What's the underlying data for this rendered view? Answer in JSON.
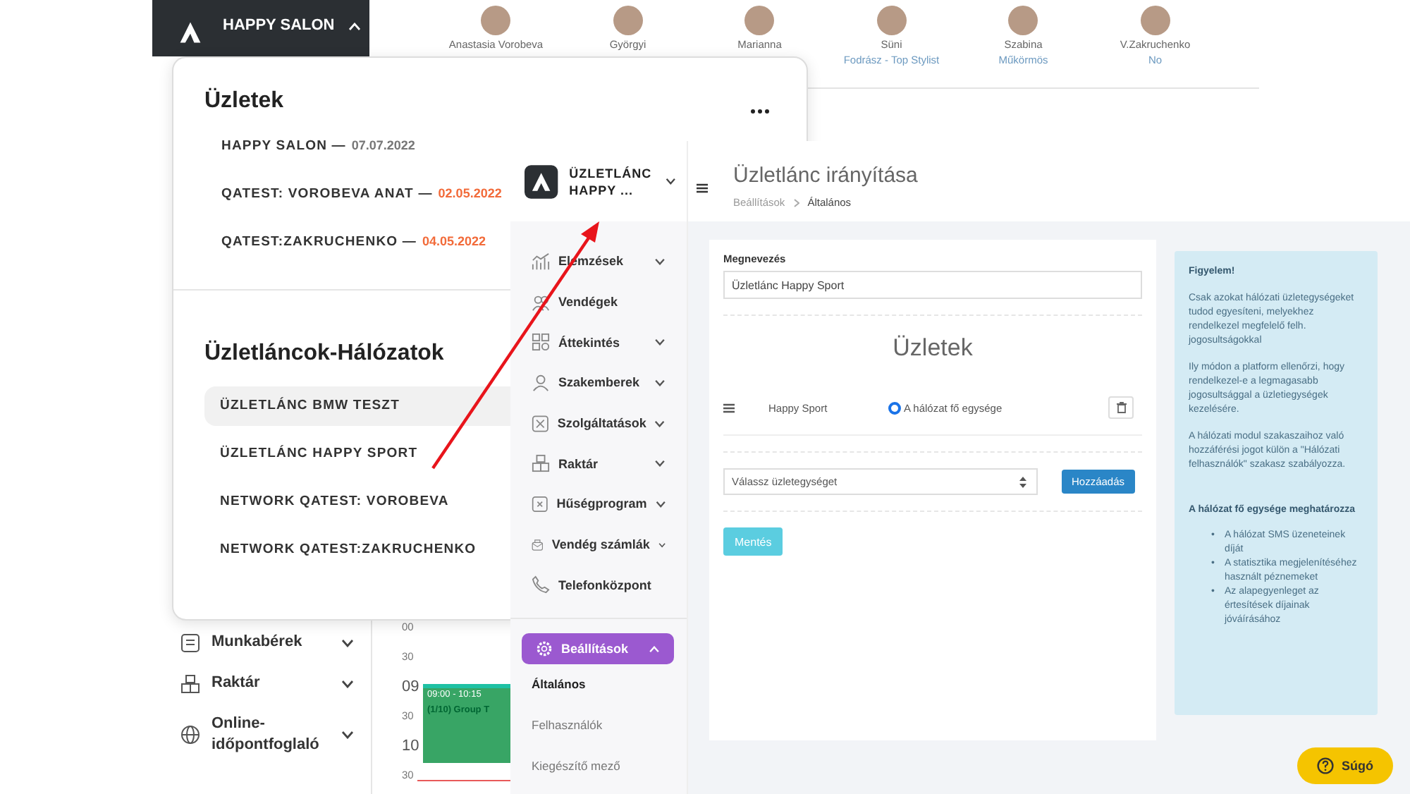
{
  "background_app": {
    "salon_switcher": {
      "label": "HAPPY SALON",
      "expanded": true
    },
    "staff": [
      {
        "name": "Anastasia Vorobeva"
      },
      {
        "name": "Györgyi"
      },
      {
        "name": "Marianna"
      },
      {
        "name": "Süni",
        "role": "Fodrász - Top Stylist"
      },
      {
        "name": "Szabina",
        "role": "Műkörmös"
      },
      {
        "name": "V.Zakruchenko",
        "role": "No"
      }
    ],
    "sidebar_items": [
      {
        "label": "Munkabérek",
        "kind": "payroll"
      },
      {
        "label": "Raktár",
        "kind": "boxes"
      },
      {
        "label": "Online-időpontfoglaló",
        "kind": "globe"
      }
    ],
    "calendar": {
      "time_labels": [
        {
          "text": "00",
          "kind": "minute"
        },
        {
          "text": "30",
          "kind": "minute"
        },
        {
          "text": "09",
          "kind": "hour"
        },
        {
          "text": "30",
          "kind": "minute"
        },
        {
          "text": "10",
          "kind": "hour"
        },
        {
          "text": "30",
          "kind": "minute"
        }
      ],
      "event": {
        "time": "09:00 - 10:15",
        "title": "(1/10) Group T"
      }
    }
  },
  "dropdown": {
    "stores_title": "Üzletek",
    "stores": [
      {
        "name": "HAPPY SALON —",
        "date": "07.07.2022",
        "color": "#777777"
      },
      {
        "name": "QATEST: VOROBEVA ANAT —",
        "date": "02.05.2022",
        "color": "#f26b3a"
      },
      {
        "name": "QATEST:ZAKRUCHENKO —",
        "date": "04.05.2022",
        "color": "#f26b3a"
      }
    ],
    "networks_title": "Üzletláncok-Hálózatok",
    "networks": [
      {
        "label": "ÜZLETLÁNC BMW TESZT",
        "selected": true
      },
      {
        "label": "ÜZLETLÁNC HAPPY SPORT",
        "selected": false
      },
      {
        "label": "NETWORK QATEST: VOROBEVA",
        "selected": false
      },
      {
        "label": "NETWORK QATEST:ZAKRUCHENKO",
        "selected": false
      }
    ]
  },
  "window": {
    "brand": "ÜZLETLÁNC HAPPY ...",
    "menu": [
      {
        "label": "Elemzések",
        "kind": "chart",
        "has_submenu": true
      },
      {
        "label": "Vendégek",
        "kind": "users",
        "has_submenu": false
      },
      {
        "label": "Áttekintés",
        "kind": "grid",
        "has_submenu": true
      },
      {
        "label": "Szakemberek",
        "kind": "person",
        "has_submenu": true
      },
      {
        "label": "Szolgáltatások",
        "kind": "scissors",
        "has_submenu": true
      },
      {
        "label": "Raktár",
        "kind": "boxes",
        "has_submenu": true
      },
      {
        "label": "Hűségprogram",
        "kind": "loyalty",
        "has_submenu": true
      },
      {
        "label": "Vendég számlák",
        "kind": "wallet",
        "has_submenu": true
      },
      {
        "label": "Telefonközpont",
        "kind": "phone",
        "has_submenu": false
      }
    ],
    "settings": {
      "label": "Beállítások",
      "expanded": true,
      "selected": true
    },
    "submenu": [
      {
        "label": "Általános",
        "selected": true
      },
      {
        "label": "Felhasználók",
        "selected": false
      },
      {
        "label": "Kiegészítő mező",
        "selected": false
      }
    ],
    "title": "Üzletlánc irányítása",
    "breadcrumb": [
      "Beállítások",
      "Általános"
    ],
    "form": {
      "name_label": "Megnevezés",
      "name_value": "Üzletlánc Happy Sport",
      "stores_heading": "Üzletek",
      "store_rows": [
        {
          "name": "Happy Sport",
          "main_label": "A hálózat fő egysége",
          "main": true
        }
      ],
      "select_placeholder": "Válassz üzletegységet",
      "add_button": "Hozzáadás",
      "save_button": "Mentés"
    },
    "info": {
      "title": "Figyelem!",
      "paragraphs": [
        "Csak azokat hálózati üzletegységeket tudod egyesíteni, melyekhez rendelkezel megfelelő felh. jogosultságokkal",
        "Ily módon a platform ellenőrzi, hogy rendelkezel-e a legmagasabb jogosultsággal a üzletiegységek kezelésére.",
        "A hálózati modul szakaszaihoz való hozzáférési jogot külön a \"Hálózati felhasználók\" szakasz szabályozza."
      ],
      "subtitle": "A hálózat fő egysége meghatározza",
      "bullets": [
        {
          "marker": "•",
          "text": "A hálózat SMS üzeneteinek díját"
        },
        {
          "marker": "•",
          "text": "A statisztika megjelenítéséhez használt péznemeket"
        },
        {
          "marker": "•",
          "text": "Az alapegyenleget az értesítések díjainak jóváírásához"
        }
      ]
    },
    "help_button": "Súgó"
  }
}
